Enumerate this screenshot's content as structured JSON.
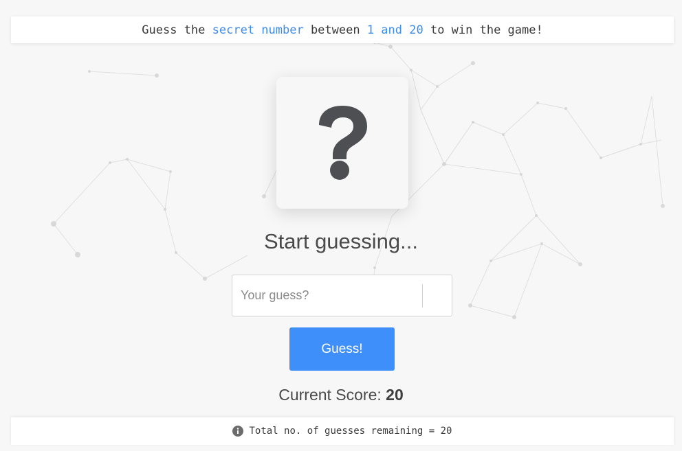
{
  "header": {
    "text_1": "Guess the ",
    "accent_1": "secret number",
    "text_2": " between ",
    "accent_2": "1 and 20",
    "text_3": " to win the game!"
  },
  "card": {
    "symbol": "?",
    "icon": "question-mark-icon"
  },
  "status_message": "Start guessing...",
  "guess_input": {
    "placeholder": "Your guess?",
    "value": ""
  },
  "guess_button": {
    "label": "Guess!"
  },
  "score": {
    "label": "Current Score: ",
    "value": "20"
  },
  "footer": {
    "icon": "info-icon",
    "text": "Total no. of guesses remaining = 20"
  },
  "colors": {
    "accent": "#3d8ce8",
    "button": "#3e8ff9",
    "question_mark": "#4d4f52",
    "background": "#f7f7f7"
  }
}
